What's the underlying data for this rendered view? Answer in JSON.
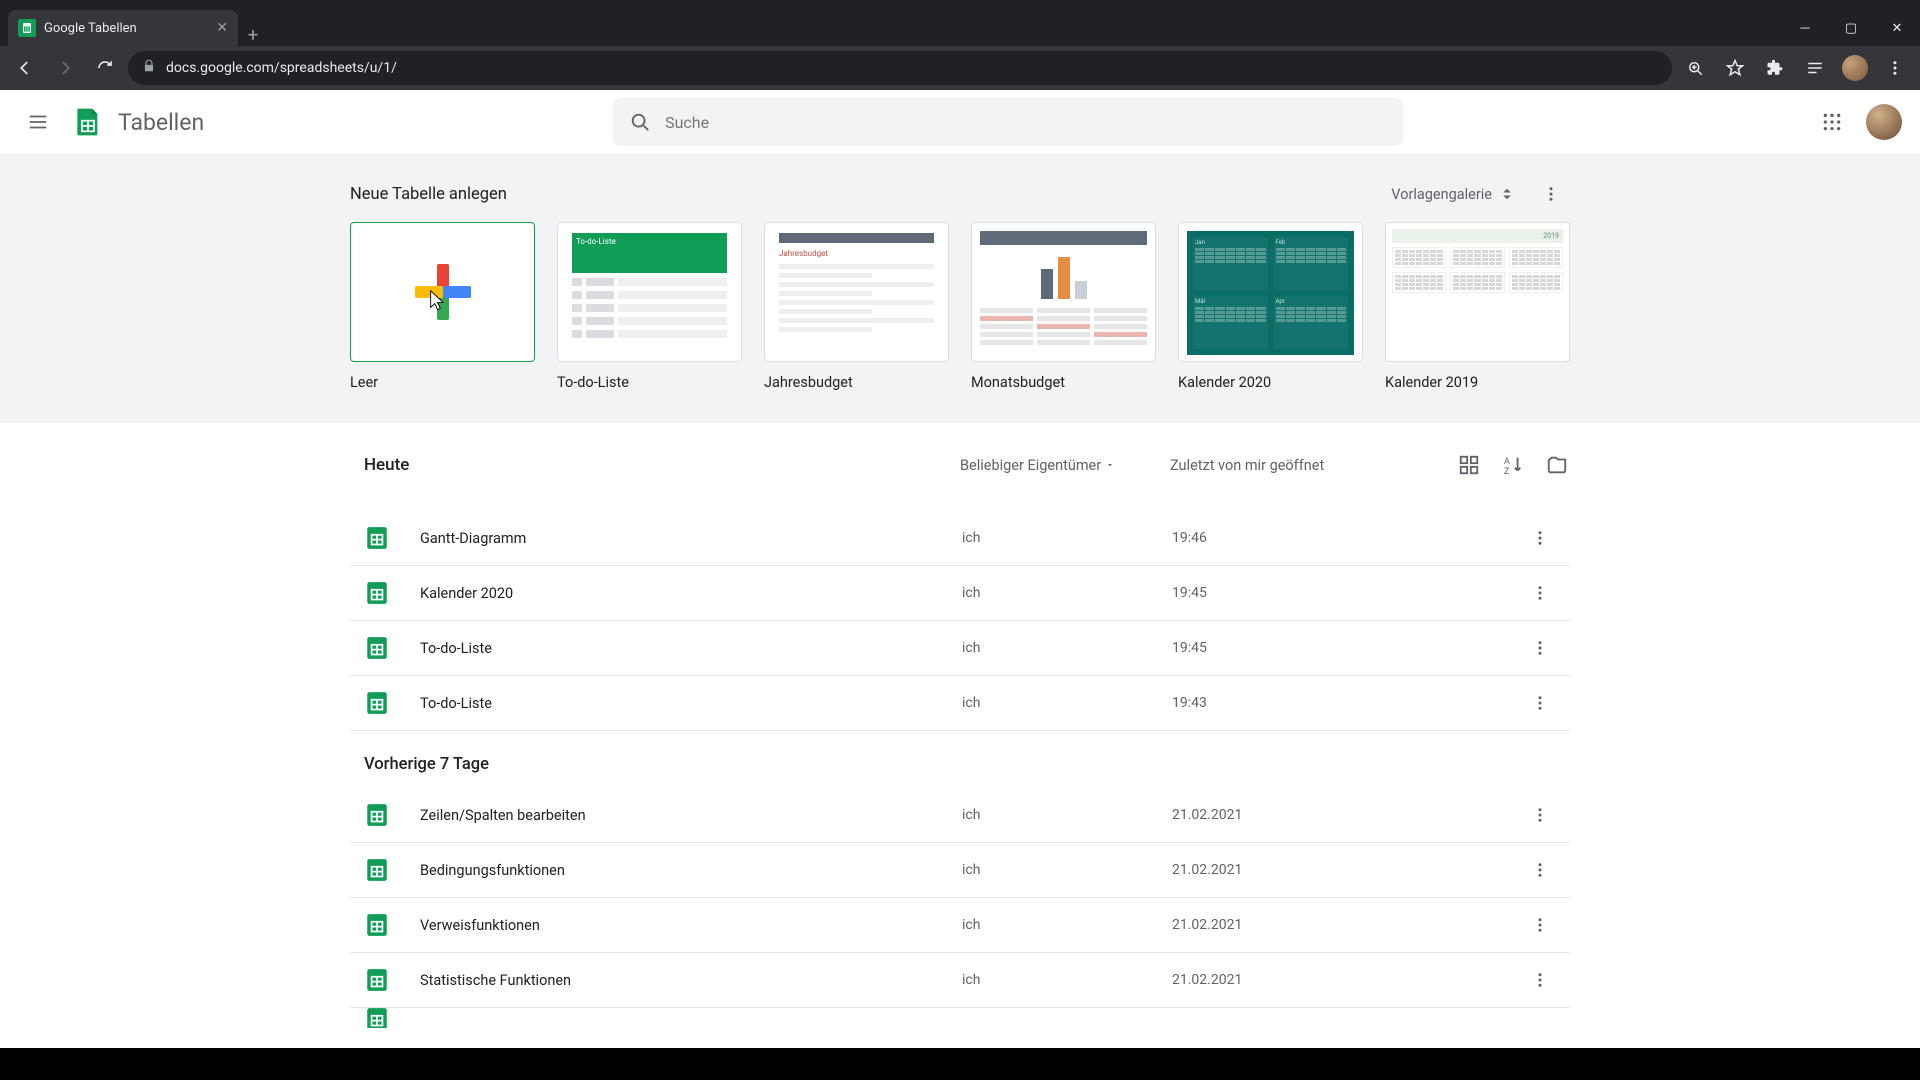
{
  "browser": {
    "tab_title": "Google Tabellen",
    "url": "docs.google.com/spreadsheets/u/1/"
  },
  "header": {
    "app_title": "Tabellen",
    "search_placeholder": "Suche"
  },
  "gallery": {
    "title": "Neue Tabelle anlegen",
    "gallery_button": "Vorlagengalerie",
    "templates": [
      {
        "label": "Leer"
      },
      {
        "label": "To-do-Liste"
      },
      {
        "label": "Jahresbudget"
      },
      {
        "label": "Monatsbudget"
      },
      {
        "label": "Kalender 2020"
      },
      {
        "label": "Kalender 2019"
      }
    ]
  },
  "filter": {
    "section_today": "Heute",
    "owner_filter": "Beliebiger Eigentümer",
    "sort_label": "Zuletzt von mir geöffnet",
    "section_prev": "Vorherige 7 Tage"
  },
  "files_today": [
    {
      "name": "Gantt-Diagramm",
      "owner": "ich",
      "time": "19:46"
    },
    {
      "name": "Kalender 2020",
      "owner": "ich",
      "time": "19:45"
    },
    {
      "name": "To-do-Liste",
      "owner": "ich",
      "time": "19:45"
    },
    {
      "name": "To-do-Liste",
      "owner": "ich",
      "time": "19:43"
    }
  ],
  "files_prev": [
    {
      "name": "Zeilen/Spalten bearbeiten",
      "owner": "ich",
      "time": "21.02.2021"
    },
    {
      "name": "Bedingungsfunktionen",
      "owner": "ich",
      "time": "21.02.2021"
    },
    {
      "name": "Verweisfunktionen",
      "owner": "ich",
      "time": "21.02.2021"
    },
    {
      "name": "Statistische Funktionen",
      "owner": "ich",
      "time": "21.02.2021"
    }
  ]
}
